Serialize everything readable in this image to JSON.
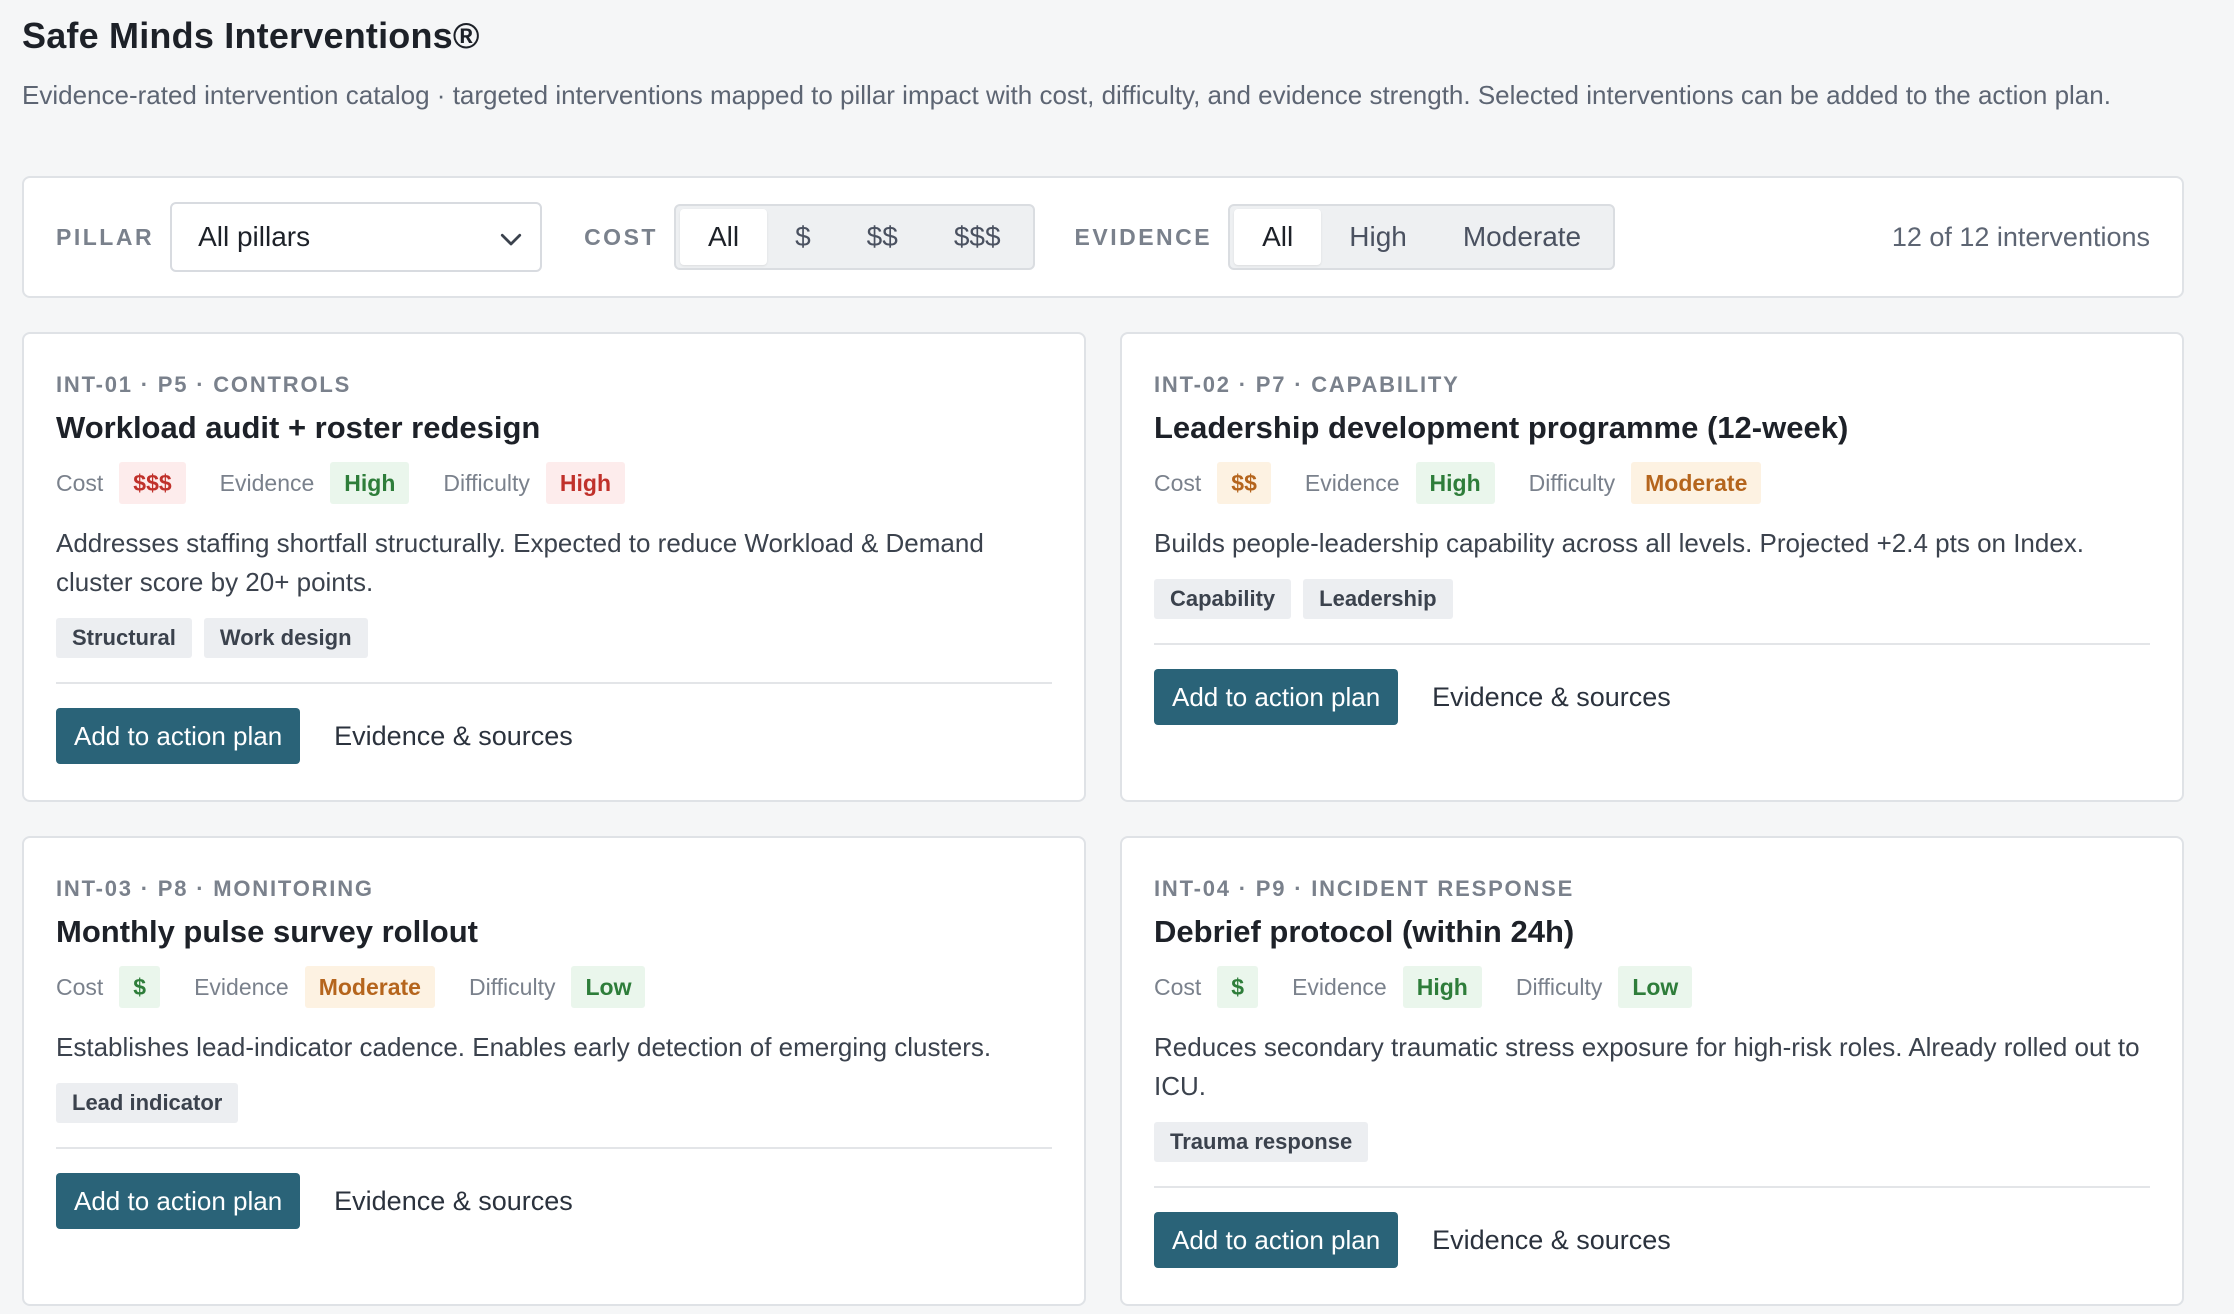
{
  "header": {
    "title": "Safe Minds Interventions®",
    "subtitle": "Evidence-rated intervention catalog · targeted interventions mapped to pillar impact with cost, difficulty, and evidence strength. Selected interventions can be added to the action plan."
  },
  "filters": {
    "pillar_label": "PILLAR",
    "pillar_value": "All pillars",
    "cost_label": "COST",
    "cost_options": [
      "All",
      "$",
      "$$",
      "$$$"
    ],
    "cost_selected": "All",
    "evidence_label": "EVIDENCE",
    "evidence_options": [
      "All",
      "High",
      "Moderate"
    ],
    "evidence_selected": "All",
    "count_text": "12 of 12 interventions"
  },
  "labels": {
    "cost": "Cost",
    "evidence": "Evidence",
    "difficulty": "Difficulty",
    "add_button": "Add to action plan",
    "sources_link": "Evidence & sources"
  },
  "colors": {
    "accent": "#2a6378",
    "high_risk": "#c0312b",
    "good": "#2e7d3a",
    "moderate": "#b5651d"
  },
  "cards": [
    {
      "meta": "INT-01 · P5 · CONTROLS",
      "title": "Workload audit + roster redesign",
      "cost": "$$$",
      "evidence": "High",
      "difficulty": "High",
      "description": "Addresses staffing shortfall structurally. Expected to reduce Workload & Demand cluster score by 20+ points.",
      "tags": [
        "Structural",
        "Work design"
      ]
    },
    {
      "meta": "INT-02 · P7 · CAPABILITY",
      "title": "Leadership development programme (12-week)",
      "cost": "$$",
      "evidence": "High",
      "difficulty": "Moderate",
      "description": "Builds people-leadership capability across all levels. Projected +2.4 pts on Index.",
      "tags": [
        "Capability",
        "Leadership"
      ]
    },
    {
      "meta": "INT-03 · P8 · MONITORING",
      "title": "Monthly pulse survey rollout",
      "cost": "$",
      "evidence": "Moderate",
      "difficulty": "Low",
      "description": "Establishes lead-indicator cadence. Enables early detection of emerging clusters.",
      "tags": [
        "Lead indicator"
      ]
    },
    {
      "meta": "INT-04 · P9 · INCIDENT RESPONSE",
      "title": "Debrief protocol (within 24h)",
      "cost": "$",
      "evidence": "High",
      "difficulty": "Low",
      "description": "Reduces secondary traumatic stress exposure for high-risk roles. Already rolled out to ICU.",
      "tags": [
        "Trauma response"
      ]
    }
  ]
}
